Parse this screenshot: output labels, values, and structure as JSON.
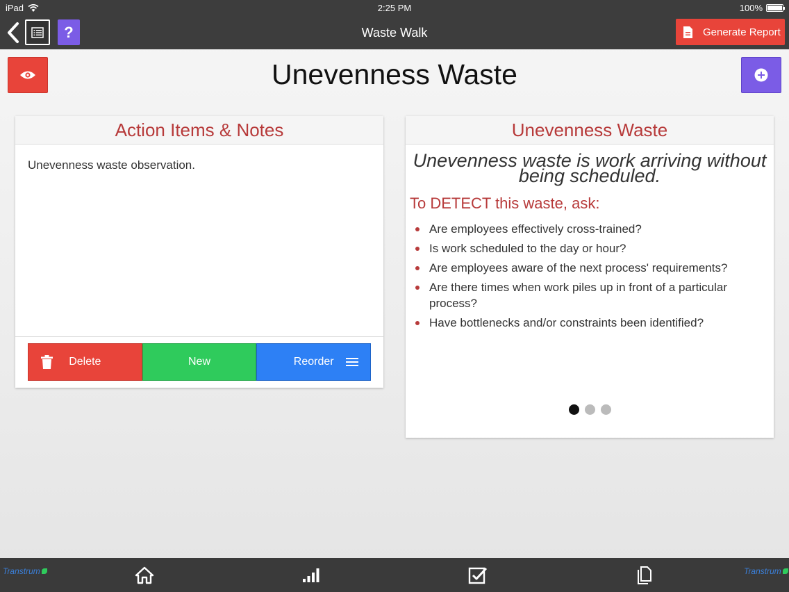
{
  "status_bar": {
    "device": "iPad",
    "time": "2:25 PM",
    "battery": "100%",
    "battery_level": 1.0
  },
  "nav": {
    "title": "Waste Walk",
    "help_label": "?",
    "generate_report_label": "Generate Report",
    "accent_red": "#e8443a",
    "accent_purple": "#7b5ce6"
  },
  "page": {
    "title": "Unevenness Waste"
  },
  "notes_card": {
    "header": "Action Items & Notes",
    "note": "Unevenness waste observation.",
    "buttons": {
      "delete": "Delete",
      "new": "New",
      "reorder": "Reorder"
    }
  },
  "info_card": {
    "header": "Unevenness Waste",
    "definition": "Unevenness waste is work arriving without being scheduled.",
    "detect_heading": "To DETECT this waste, ask:",
    "questions": [
      "Are employees effectively cross-trained?",
      "Is work scheduled to the day or hour?",
      "Are employees aware of the next process' requirements?",
      "Are there times when work piles up in front of a particular process?",
      "Have bottlenecks and/or constraints been identified?"
    ],
    "page_count": 3,
    "current_page": 1
  },
  "tab_bar": {
    "brand_left": "Transtrum",
    "brand_right": "Transtrum",
    "icons": [
      "home-icon",
      "signal-bars-icon",
      "checkbox-icon",
      "documents-icon"
    ]
  }
}
